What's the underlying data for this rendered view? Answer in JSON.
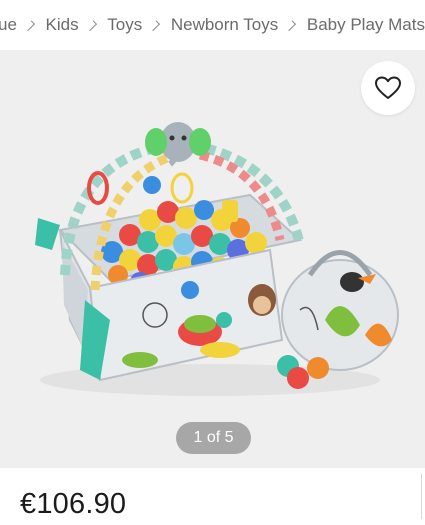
{
  "breadcrumb": {
    "items": [
      {
        "label": "ue"
      },
      {
        "label": "Kids"
      },
      {
        "label": "Toys"
      },
      {
        "label": "Newborn Toys"
      },
      {
        "label": "Baby Play Mats"
      }
    ]
  },
  "gallery": {
    "pager_text": "1 of 5",
    "favorite_icon": "heart-outline-icon"
  },
  "product": {
    "price": "€106.90"
  }
}
